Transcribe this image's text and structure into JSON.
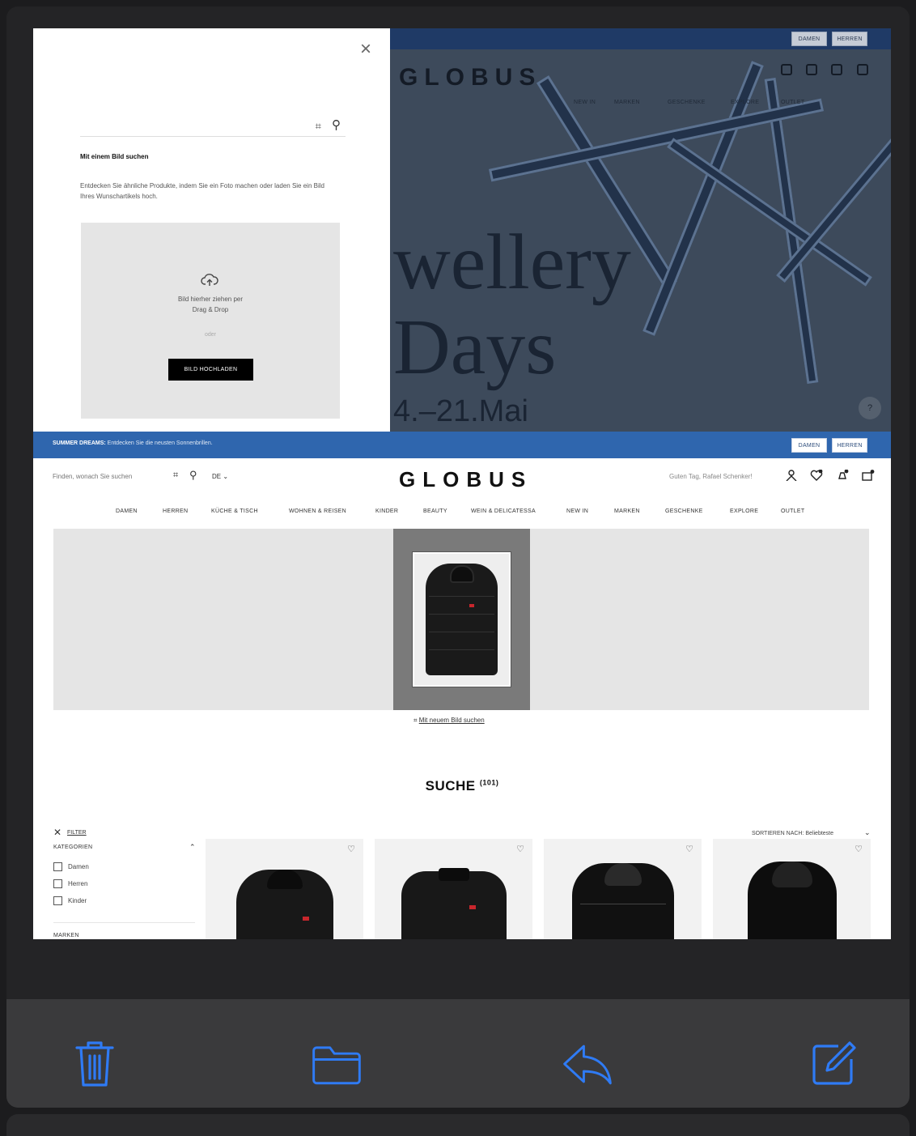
{
  "top_window": {
    "hero": {
      "pill_damen": "DAMEN",
      "pill_herren": "HERREN",
      "logo": "GLOBUS",
      "nav": [
        "NEW IN",
        "MARKEN",
        "GESCHENKE",
        "EXPLORE",
        "OUTLET"
      ],
      "headline_1": "wellery",
      "headline_2": "Days",
      "date": "4.–21.Mai",
      "help": "?"
    },
    "modal": {
      "search_placeholder": "",
      "heading": "Mit einem Bild suchen",
      "description": "Entdecken Sie ähnliche Produkte, indem Sie ein Foto machen oder laden Sie ein Bild Ihres Wunschartikels hoch.",
      "drop_text_1": "Bild hierher ziehen per",
      "drop_text_2": "Drag & Drop",
      "or": "oder",
      "upload_button": "BILD HOCHLADEN",
      "close": "×"
    }
  },
  "page": {
    "promo": {
      "strong": "SUMMER DREAMS:",
      "text": " Entdecken Sie die neusten Sonnenbrillen.",
      "pill_damen": "DAMEN",
      "pill_herren": "HERREN"
    },
    "header": {
      "search_placeholder": "Finden, wonach Sie suchen",
      "lang": "DE ⌄",
      "logo": "GLOBUS",
      "greeting": "Guten Tag, Rafael Schenker!"
    },
    "nav": [
      "DAMEN",
      "HERREN",
      "KÜCHE & TISCH",
      "WOHNEN & REISEN",
      "KINDER",
      "BEAUTY",
      "WEIN & DELICATESSA",
      "NEW IN",
      "MARKEN",
      "GESCHENKE",
      "EXPLORE",
      "OUTLET"
    ],
    "new_image_search": "Mit neuem Bild suchen",
    "search_title": "SUCHE",
    "result_count": "(101)",
    "filters": {
      "filter_label": "FILTER",
      "category_heading": "KATEGORIEN",
      "categories": [
        "Damen",
        "Herren",
        "Kinder"
      ],
      "brands_heading": "MARKEN"
    },
    "sort_label": "SORTIEREN NACH: Beliebteste"
  },
  "toolbar": {
    "delete": "trash-icon",
    "move": "folder-icon",
    "reply": "reply-icon",
    "compose": "compose-icon",
    "accent": "#2f7bf5"
  }
}
